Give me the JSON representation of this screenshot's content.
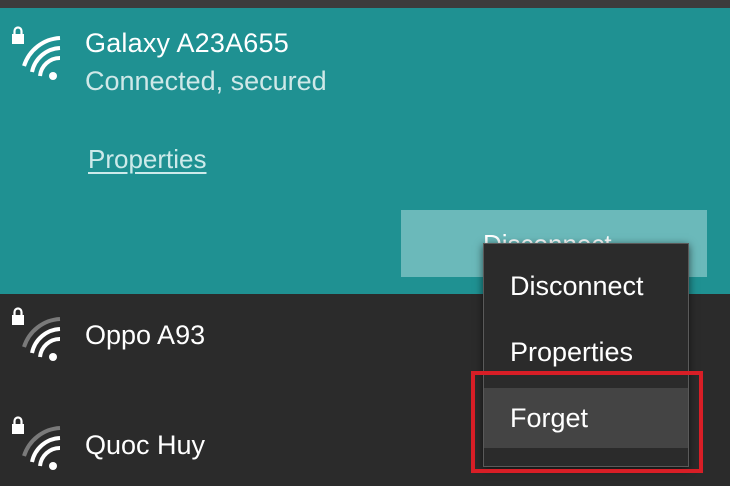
{
  "connected_network": {
    "name": "Galaxy A23A655",
    "status": "Connected, secured",
    "properties_link": "Properties",
    "disconnect_label": "Disconnect",
    "icon": "wifi-secured-full-icon"
  },
  "networks": [
    {
      "name": "Oppo A93",
      "icon": "wifi-secured-weak-icon"
    },
    {
      "name": "Quoc Huy",
      "icon": "wifi-secured-weak-icon"
    }
  ],
  "context_menu": {
    "items": [
      {
        "label": "Disconnect"
      },
      {
        "label": "Properties"
      },
      {
        "label": "Forget",
        "highlighted": true
      }
    ]
  },
  "colors": {
    "accent": "#1f9192",
    "button": "#6bb9ba",
    "background": "#2b2b2b",
    "highlight": "#d81e26"
  }
}
